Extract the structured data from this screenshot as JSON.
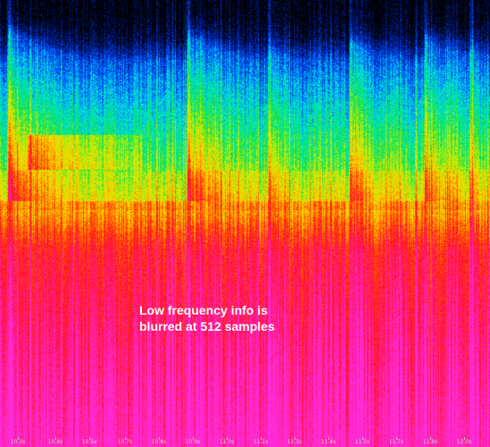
{
  "chart_data": {
    "type": "heatmap",
    "title": "",
    "xlabel": "",
    "ylabel": "",
    "annotation": "Low frequency info is\nblurred at 512 samples",
    "colormap": [
      "#000000",
      "#001a8c",
      "#0050ff",
      "#00e8e8",
      "#00e050",
      "#c8f000",
      "#ffd000",
      "#ff5a00",
      "#ff1020",
      "#ff1c8c",
      "#ff2cd8"
    ],
    "x_ticks": [
      "10.3s",
      "10.4s",
      "10.5s",
      "10.7s",
      "10.8s",
      "10.9s",
      "11.0s",
      "11.1s",
      "11.3s",
      "11.4s",
      "11.5s",
      "11.7s",
      "11.8s",
      "12.0s"
    ],
    "onsets": [
      {
        "t": 10.33,
        "energy": 0.95
      },
      {
        "t": 10.97,
        "energy": 0.85
      },
      {
        "t": 11.26,
        "energy": 0.55
      },
      {
        "t": 11.55,
        "energy": 0.7
      },
      {
        "t": 11.82,
        "energy": 0.75
      },
      {
        "t": 11.98,
        "energy": 0.55
      }
    ]
  }
}
